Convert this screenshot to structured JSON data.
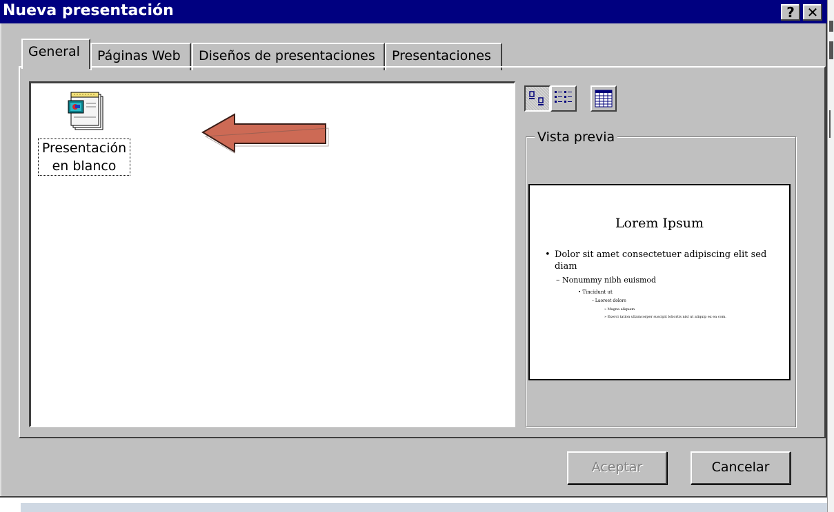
{
  "window": {
    "title": "Nueva presentación",
    "help_button": "?",
    "close_button": "✕"
  },
  "tabs": [
    {
      "label": "General",
      "active": true
    },
    {
      "label": "Páginas Web",
      "active": false
    },
    {
      "label": "Diseños de presentaciones",
      "active": false
    },
    {
      "label": "Presentaciones",
      "active": false
    }
  ],
  "templates": [
    {
      "label_line1": "Presentación",
      "label_line2": "en blanco",
      "icon": "presentation-document-icon",
      "selected": true
    }
  ],
  "view_buttons": [
    {
      "icon": "large-icons-view-icon",
      "pressed": true
    },
    {
      "icon": "list-view-icon",
      "pressed": false
    },
    {
      "icon": "details-view-icon",
      "pressed": false
    }
  ],
  "preview": {
    "legend": "Vista previa",
    "slide_title": "Lorem Ipsum",
    "bullet_l1": "Dolor sit amet consectetuer adipiscing elit sed diam",
    "bullet_l2": "– Nonummy nibh euismod",
    "bullet_l3": "• Tincidunt ut",
    "bullet_l4": "– Laoreet dolore",
    "bullet_l5": "» Magna aliquam",
    "bullet_l6": "» Exerci tation ullamcorper suscipit lobortis nisl ut aliquip ex ea com."
  },
  "buttons": {
    "ok": "Aceptar",
    "ok_disabled": true,
    "cancel": "Cancelar"
  },
  "colors": {
    "titlebar": "#000080",
    "face": "#c0c0c0",
    "arrow_fill": "#cd6a55"
  }
}
